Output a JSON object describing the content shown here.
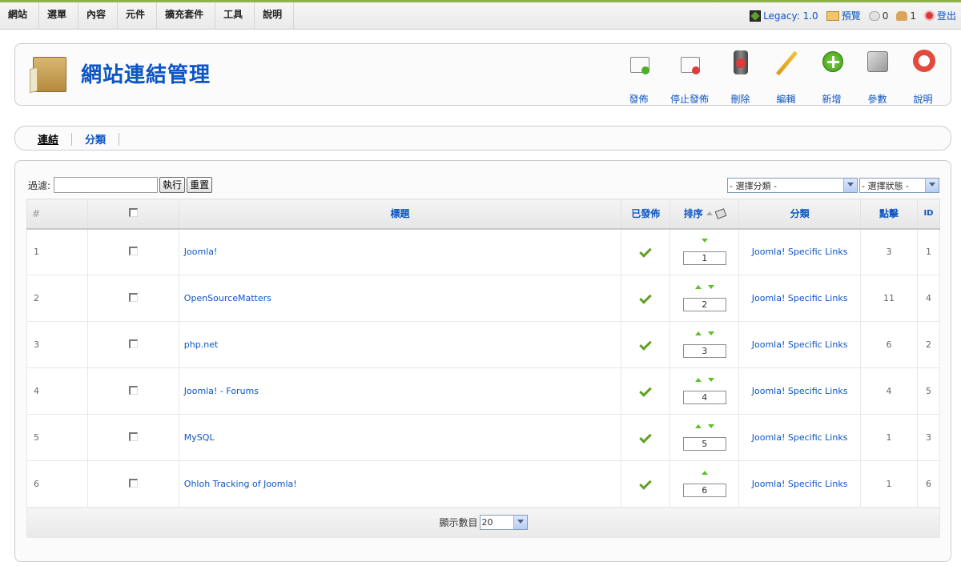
{
  "menu": {
    "items": [
      "網站",
      "選單",
      "內容",
      "元件",
      "擴充套件",
      "工具",
      "說明"
    ]
  },
  "status": {
    "legacy": "Legacy: 1.0",
    "preview": "預覽",
    "messages": "0",
    "users": "1",
    "logout": "登出"
  },
  "header": {
    "title": "網站連結管理",
    "actions": {
      "publish": "發佈",
      "unpublish": "停止發佈",
      "delete": "刪除",
      "edit": "編輯",
      "new": "新增",
      "params": "參數",
      "help": "說明"
    }
  },
  "submenu": {
    "links": "連結",
    "categories": "分類"
  },
  "filter": {
    "label": "過濾:",
    "value": "",
    "go": "執行",
    "reset": "重置",
    "category_select": "- 選擇分類 -",
    "state_select": "- 選擇狀態 -"
  },
  "table": {
    "headers": {
      "num": "#",
      "title": "標題",
      "published": "已發佈",
      "order": "排序",
      "category": "分類",
      "hits": "點擊",
      "id": "ID"
    },
    "rows": [
      {
        "num": "1",
        "title": "Joomla!",
        "order": "1",
        "category": "Joomla! Specific Links",
        "hits": "3",
        "id": "1"
      },
      {
        "num": "2",
        "title": "OpenSourceMatters",
        "order": "2",
        "category": "Joomla! Specific Links",
        "hits": "11",
        "id": "4"
      },
      {
        "num": "3",
        "title": "php.net",
        "order": "3",
        "category": "Joomla! Specific Links",
        "hits": "6",
        "id": "2"
      },
      {
        "num": "4",
        "title": "Joomla! - Forums",
        "order": "4",
        "category": "Joomla! Specific Links",
        "hits": "4",
        "id": "5"
      },
      {
        "num": "5",
        "title": "MySQL",
        "order": "5",
        "category": "Joomla! Specific Links",
        "hits": "1",
        "id": "3"
      },
      {
        "num": "6",
        "title": "Ohloh Tracking of Joomla!",
        "order": "6",
        "category": "Joomla! Specific Links",
        "hits": "1",
        "id": "6"
      }
    ],
    "footer": {
      "display_label": "顯示數目",
      "limit": "20"
    }
  },
  "colors": {
    "accent": "#0b55c4",
    "top_border": "#8fb24d",
    "check": "#5ea11f"
  }
}
